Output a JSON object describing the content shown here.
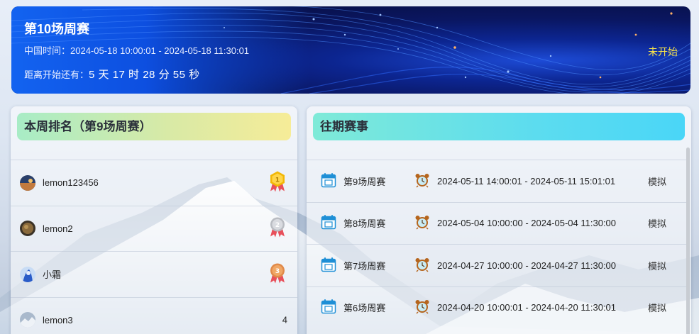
{
  "banner": {
    "title": "第10场周赛",
    "time_label": "中国时间：",
    "time_range": "2024-05-18 10:00:01 - 2024-05-18 11:30:01",
    "countdown_label": "距离开始还有：",
    "countdown": "5 天 17 时 28 分 55 秒",
    "status": "未开始"
  },
  "ranking": {
    "title": "本周排名（第9场周赛）",
    "rows": [
      {
        "name": "lemon123456",
        "rank": "1"
      },
      {
        "name": "lemon2",
        "rank": "2"
      },
      {
        "name": "小霜",
        "rank": "3"
      },
      {
        "name": "lemon3",
        "rank": "4"
      }
    ]
  },
  "past": {
    "title": "往期赛事",
    "rows": [
      {
        "name": "第9场周赛",
        "time": "2024-05-11 14:00:01 - 2024-05-11 15:01:01",
        "action": "模拟"
      },
      {
        "name": "第8场周赛",
        "time": "2024-05-04 10:00:00 - 2024-05-04 11:30:00",
        "action": "模拟"
      },
      {
        "name": "第7场周赛",
        "time": "2024-04-27 10:00:00 - 2024-04-27 11:30:00",
        "action": "模拟"
      },
      {
        "name": "第6场周赛",
        "time": "2024-04-20 10:00:01 - 2024-04-20 11:30:01",
        "action": "模拟"
      }
    ]
  },
  "icons": {
    "calendar": "calendar-icon",
    "clock": "alarm-clock-icon",
    "medal": "medal-icon"
  },
  "colors": {
    "status": "#f6e24a",
    "banner_blue": "#1363f0",
    "gold": "#f2b705",
    "silver": "#b9bcc2",
    "bronze": "#e08a4a",
    "ribbon": "#e8505b"
  }
}
